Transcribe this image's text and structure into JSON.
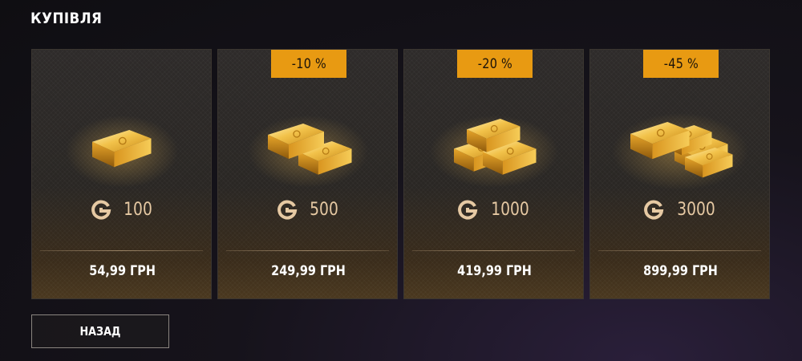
{
  "header": {
    "title": "КУПІВЛЯ"
  },
  "offers": [
    {
      "discount": "",
      "gold_icon": "gold-coin-icon",
      "amount": "100",
      "price": "54,99 ГРН"
    },
    {
      "discount": "-10 %",
      "gold_icon": "gold-coin-icon",
      "amount": "500",
      "price": "249,99 ГРН"
    },
    {
      "discount": "-20 %",
      "gold_icon": "gold-coin-icon",
      "amount": "1000",
      "price": "419,99 ГРН"
    },
    {
      "discount": "-45 %",
      "gold_icon": "gold-coin-icon",
      "amount": "3000",
      "price": "899,99 ГРН"
    }
  ],
  "footer": {
    "back_label": "НАЗАД"
  },
  "colors": {
    "accent": "#e89a12",
    "gold": "#e6c9a3"
  }
}
